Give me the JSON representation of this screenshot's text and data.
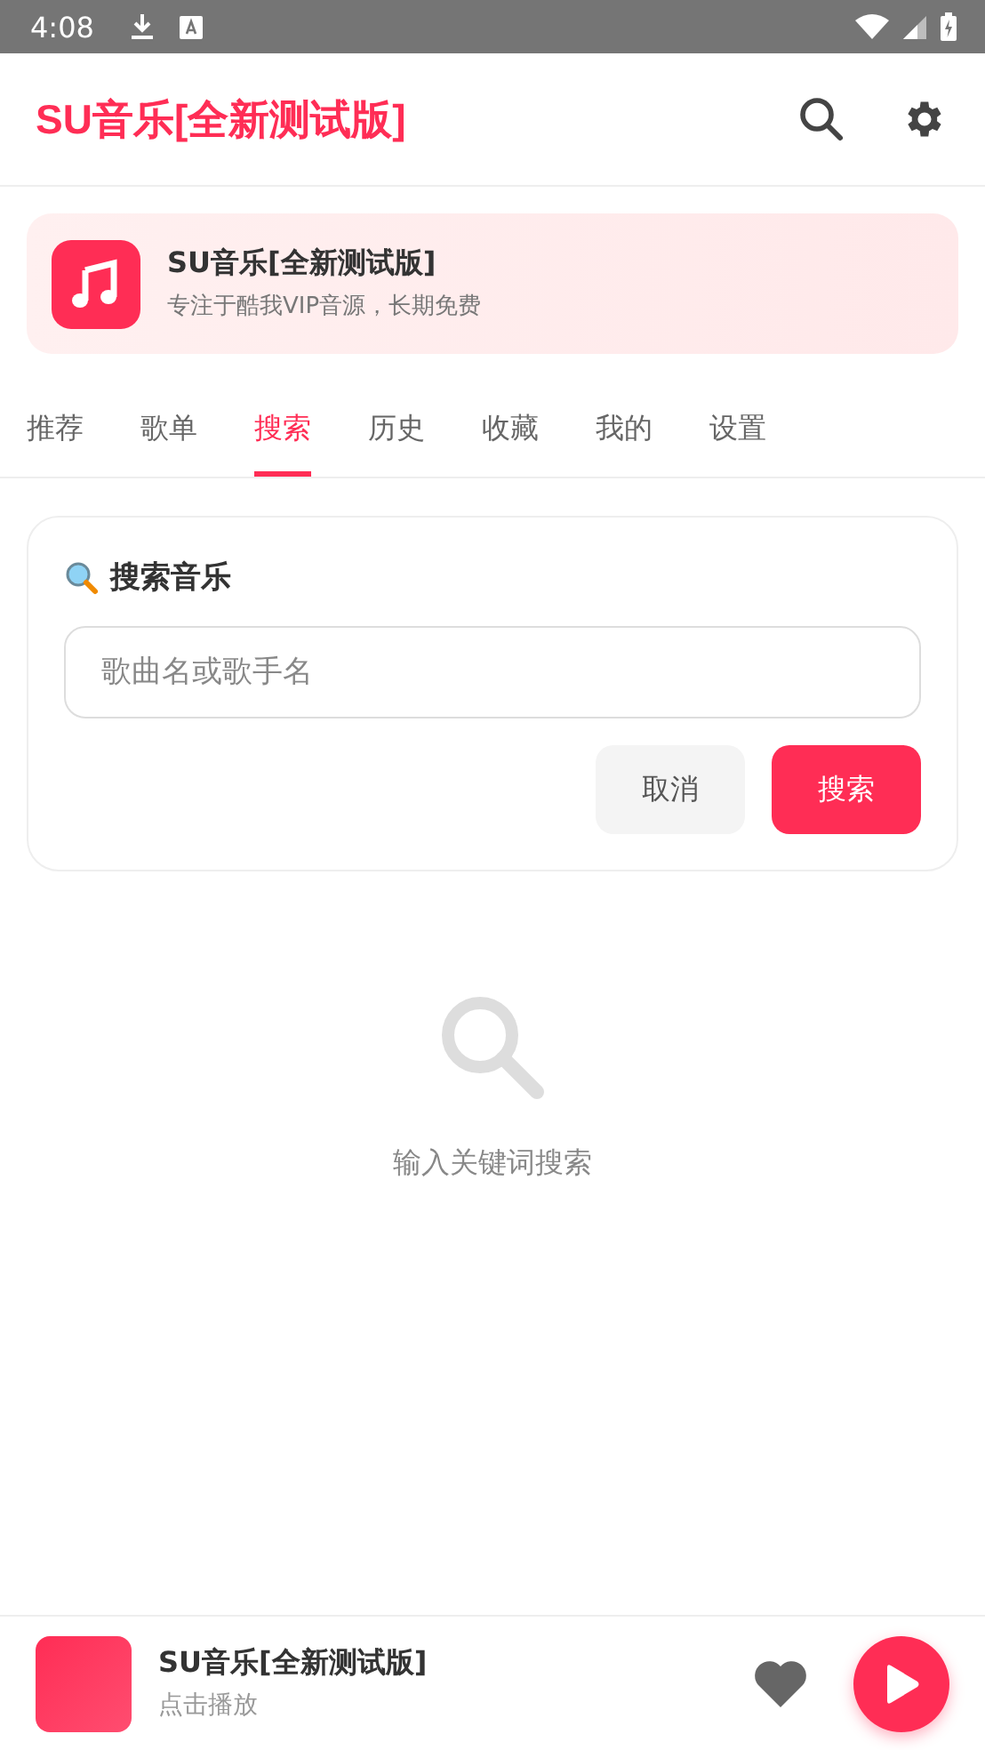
{
  "status_bar": {
    "time": "4:08"
  },
  "app_bar": {
    "title": "SU音乐[全新测试版]"
  },
  "banner": {
    "title": "SU音乐[全新测试版]",
    "subtitle": "专注于酷我VIP音源，长期免费"
  },
  "tabs": [
    {
      "label": "推荐",
      "selected": false
    },
    {
      "label": "歌单",
      "selected": false
    },
    {
      "label": "搜索",
      "selected": true
    },
    {
      "label": "历史",
      "selected": false
    },
    {
      "label": "收藏",
      "selected": false
    },
    {
      "label": "我的",
      "selected": false
    },
    {
      "label": "设置",
      "selected": false
    }
  ],
  "search_card": {
    "title": "搜索音乐",
    "placeholder": "歌曲名或歌手名",
    "buttons": [
      {
        "label": "取消",
        "kind": "secondary"
      },
      {
        "label": "搜索",
        "kind": "primary"
      }
    ]
  },
  "empty_state": {
    "text": "输入关键词搜索"
  },
  "player": {
    "title": "SU音乐[全新测试版]",
    "subtitle": "点击播放"
  }
}
